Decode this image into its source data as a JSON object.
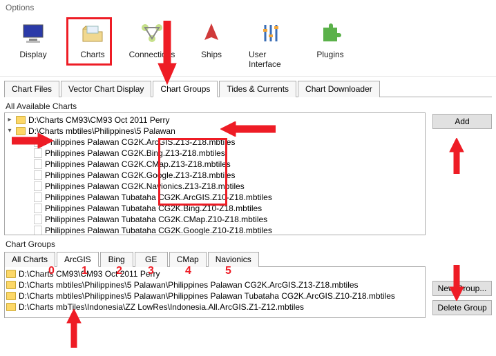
{
  "window": {
    "title": "Options"
  },
  "toolbar": {
    "display": "Display",
    "charts": "Charts",
    "connections": "Connections",
    "ships": "Ships",
    "ui": "User Interface",
    "plugins": "Plugins"
  },
  "tabs": {
    "chart_files": "Chart Files",
    "vector": "Vector Chart Display",
    "groups": "Chart Groups",
    "tides": "Tides & Currents",
    "downloader": "Chart Downloader"
  },
  "labels": {
    "all_charts": "All Available Charts",
    "chart_groups": "Chart Groups"
  },
  "buttons": {
    "add": "Add",
    "new_group": "New Group...",
    "delete_group": "Delete Group"
  },
  "tree": {
    "root1": "D:\\Charts CM93\\CM93 Oct 2011 Perry",
    "root2": "D:\\Charts mbtiles\\Philippines\\5 Palawan",
    "items": [
      "Philippines Palawan CG2K.ArcGIS.Z13-Z18.mbtiles",
      "Philippines Palawan CG2K.Bing.Z13-Z18.mbtiles",
      "Philippines Palawan CG2K.CMap.Z13-Z18.mbtiles",
      "Philippines Palawan CG2K.Google.Z13-Z18.mbtiles",
      "Philippines Palawan CG2K.Navionics.Z13-Z18.mbtiles",
      "Philippines Palawan Tubataha CG2K.ArcGIS.Z10-Z18.mbtiles",
      "Philippines Palawan Tubataha CG2K.Bing.Z10-Z18.mbtiles",
      "Philippines Palawan Tubataha CG2K.CMap.Z10-Z18.mbtiles",
      "Philippines Palawan Tubataha CG2K.Google.Z10-Z18.mbtiles"
    ]
  },
  "group_tabs": {
    "all": "All Charts",
    "arcgis": "ArcGIS",
    "bing": "Bing",
    "ge": "GE",
    "cmap": "CMap",
    "nav": "Navionics"
  },
  "group_list": [
    "D:\\Charts CM93\\CM93 Oct 2011 Perry",
    "D:\\Charts mbtiles\\Philippines\\5 Palawan\\Philippines Palawan CG2K.ArcGIS.Z13-Z18.mbtiles",
    "D:\\Charts mbtiles\\Philippines\\5 Palawan\\Philippines Palawan Tubataha CG2K.ArcGIS.Z10-Z18.mbtiles",
    "D:\\Charts mbTiles\\Indonesia\\ZZ LowRes\\Indonesia.All.ArcGIS.Z1-Z12.mbtiles"
  ],
  "annot_nums": [
    "0",
    "1",
    "2",
    "3",
    "4",
    "5"
  ]
}
